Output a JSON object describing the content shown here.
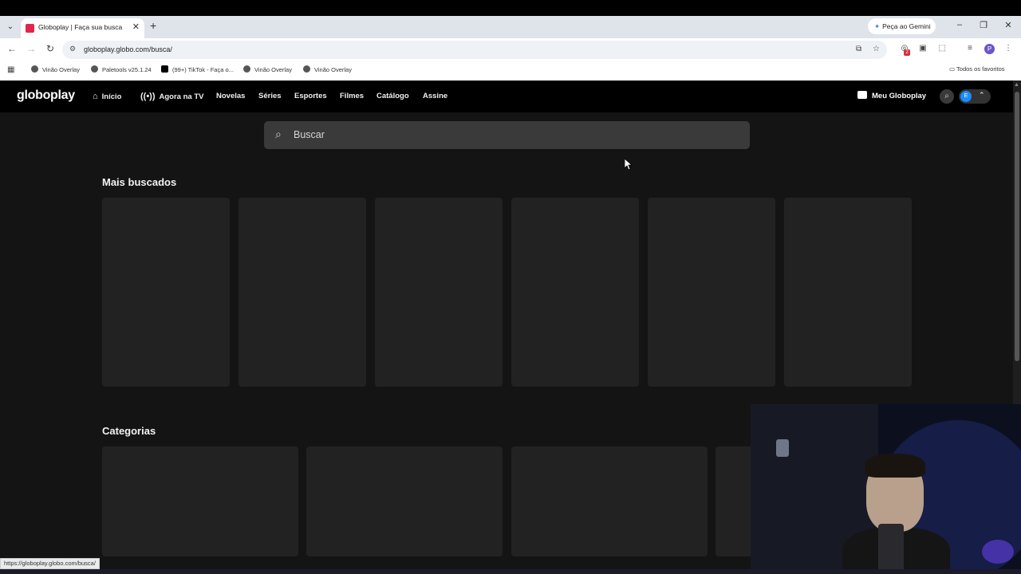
{
  "browser": {
    "tab_title": "Globoplay | Faça sua busca",
    "gemini_label": "Peça ao Gemini",
    "url": "globoplay.globo.com/busca/",
    "bookmarks": [
      "Vinão Overlay",
      "Paletools v25.1.24",
      "(99+) TikTok - Faça o...",
      "Vinão Overlay",
      "Vinão Overlay"
    ],
    "bookmarks_folder": "Todos os favoritos",
    "status_url": "https://globoplay.globo.com/busca/",
    "extension_badge": "2",
    "profile_initial": "P"
  },
  "site": {
    "logo": "globoplay",
    "nav": [
      "Início",
      "Agora na TV",
      "Novelas",
      "Séries",
      "Esportes",
      "Filmes",
      "Catálogo",
      "Assine"
    ],
    "meu_globoplay": "Meu Globoplay",
    "avatar_initial": "E"
  },
  "search": {
    "placeholder": "Buscar"
  },
  "sections": {
    "most_searched": "Mais buscados",
    "categories": "Categorias"
  },
  "colors": {
    "page_bg": "#141414",
    "header_bg": "#000000",
    "card_bg": "#222222",
    "search_bg": "#3a3a3a",
    "avatar": "#1a8cff"
  }
}
